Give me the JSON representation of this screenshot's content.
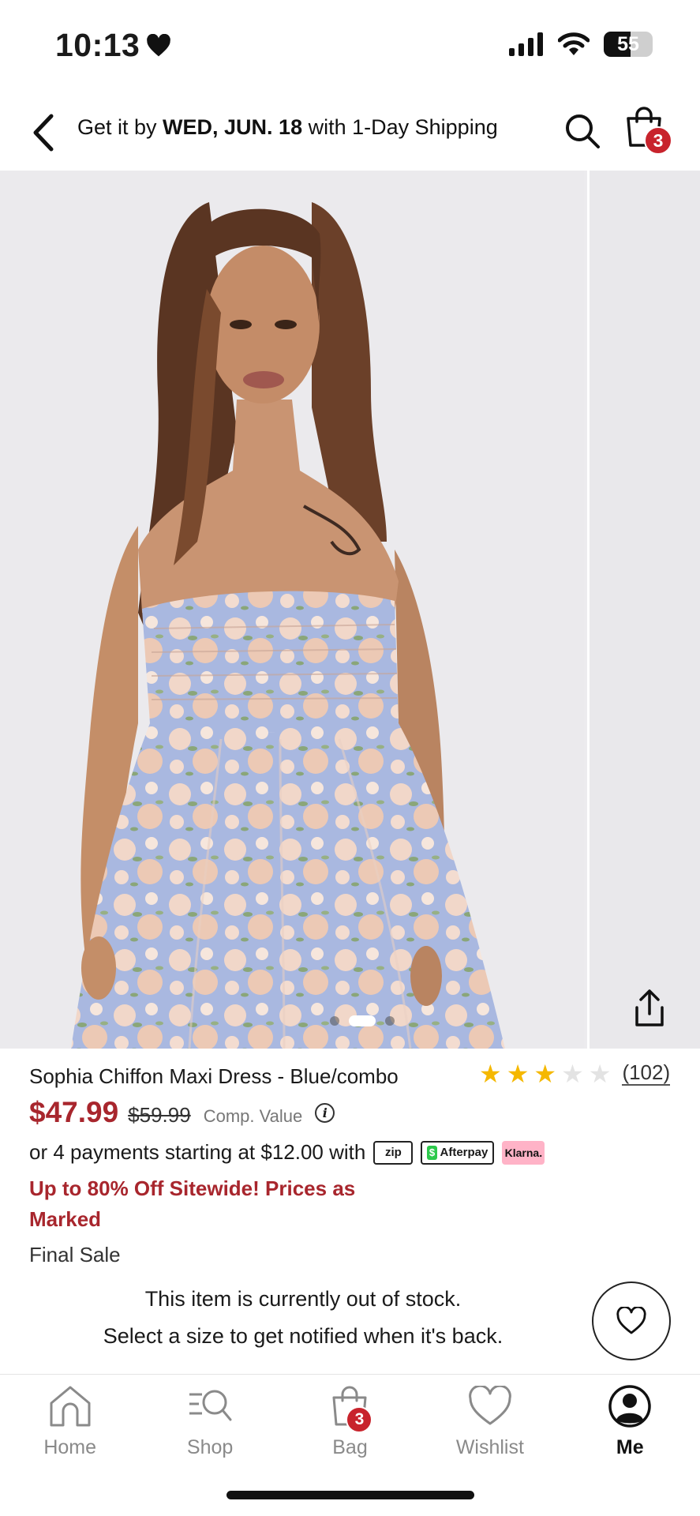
{
  "status_bar": {
    "time": "10:13",
    "battery_level": "55"
  },
  "header": {
    "delivery_prefix": "Get it by ",
    "delivery_date": "WED, JUN. 18",
    "delivery_suffix": " with 1-Day Shipping",
    "bag_count": "3"
  },
  "gallery": {
    "slide_count": 3,
    "active_slide": 2
  },
  "product": {
    "title": "Sophia Chiffon Maxi Dress - Blue/combo",
    "rating": 3,
    "rating_max": 5,
    "review_count": "(102)",
    "sale_price": "$47.99",
    "original_price": "$59.99",
    "comp_value_label": "Comp. Value",
    "installments_text": "or 4 payments starting at $12.00 with",
    "payment_providers": [
      "zip",
      "Afterpay",
      "Klarna."
    ],
    "promo": "Up to 80% Off Sitewide! Prices as Marked",
    "final_sale": "Final Sale"
  },
  "stock": {
    "line1": "This item is currently out of stock.",
    "line2": "Select a size to get notified when it's back."
  },
  "tab_bar": {
    "items": [
      {
        "label": "Home",
        "icon": "home-icon"
      },
      {
        "label": "Shop",
        "icon": "shop-search-icon"
      },
      {
        "label": "Bag",
        "icon": "bag-icon",
        "badge": "3"
      },
      {
        "label": "Wishlist",
        "icon": "heart-icon"
      },
      {
        "label": "Me",
        "icon": "profile-icon",
        "active": true
      }
    ]
  },
  "colors": {
    "accent_red": "#a8262d",
    "badge_red": "#c8232c",
    "star_yellow": "#f5b800",
    "afterpay_green": "#2cc94b",
    "klarna_pink": "#ffb3c7"
  }
}
